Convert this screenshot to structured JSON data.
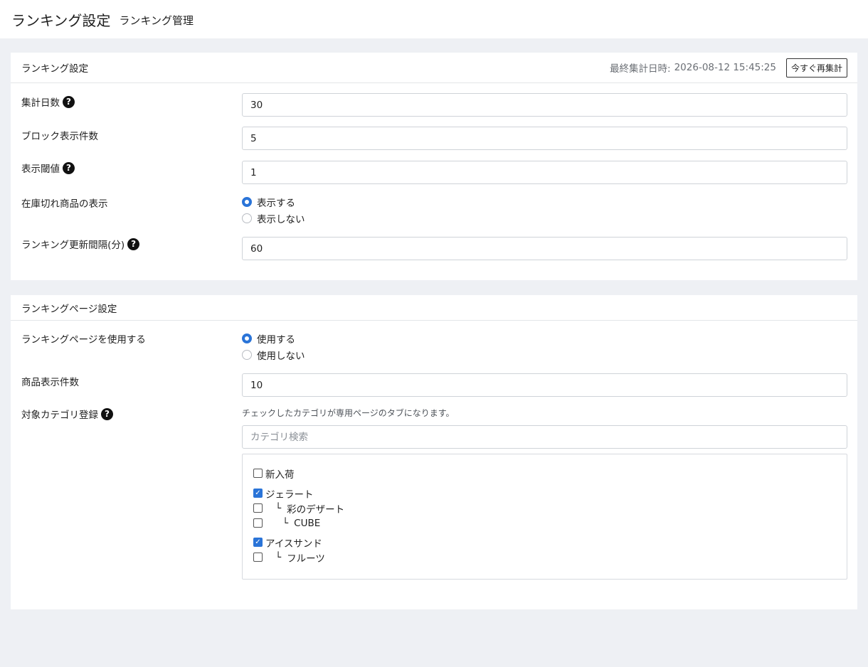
{
  "header": {
    "title": "ランキング設定",
    "subtitle": "ランキング管理"
  },
  "card1": {
    "title": "ランキング設定",
    "last_run_label": "最終集計日時:",
    "last_run_value": "2026-08-12 15:45:25",
    "recalc_button": "今すぐ再集計",
    "fields": {
      "days": {
        "label": "集計日数",
        "value": "30"
      },
      "block_count": {
        "label": "ブロック表示件数",
        "value": "5"
      },
      "threshold": {
        "label": "表示閾値",
        "value": "1"
      },
      "out_of_stock": {
        "label": "在庫切れ商品の表示",
        "options": [
          "表示する",
          "表示しない"
        ],
        "selected": "表示する"
      },
      "interval": {
        "label": "ランキング更新間隔(分)",
        "value": "60"
      }
    }
  },
  "card2": {
    "title": "ランキングページ設定",
    "fields": {
      "use_page": {
        "label": "ランキングページを使用する",
        "options": [
          "使用する",
          "使用しない"
        ],
        "selected": "使用する"
      },
      "item_count": {
        "label": "商品表示件数",
        "value": "10"
      },
      "categories": {
        "label": "対象カテゴリ登録",
        "hint": "チェックしたカテゴリが専用ページのタブになります。",
        "search_placeholder": "カテゴリ検索",
        "tree_mark": "└",
        "items": [
          {
            "name": "新入荷",
            "checked": false,
            "depth": 0
          },
          {
            "name": "ジェラート",
            "checked": true,
            "depth": 0
          },
          {
            "name": "彩のデザート",
            "checked": false,
            "depth": 1
          },
          {
            "name": "CUBE",
            "checked": false,
            "depth": 2
          },
          {
            "name": "アイスサンド",
            "checked": true,
            "depth": 0
          },
          {
            "name": "フルーツ",
            "checked": false,
            "depth": 1
          }
        ]
      }
    }
  },
  "help_glyph": "?",
  "check_glyph": "✓",
  "colors": {
    "accent": "#2a74d8",
    "background": "#eef0f4"
  }
}
